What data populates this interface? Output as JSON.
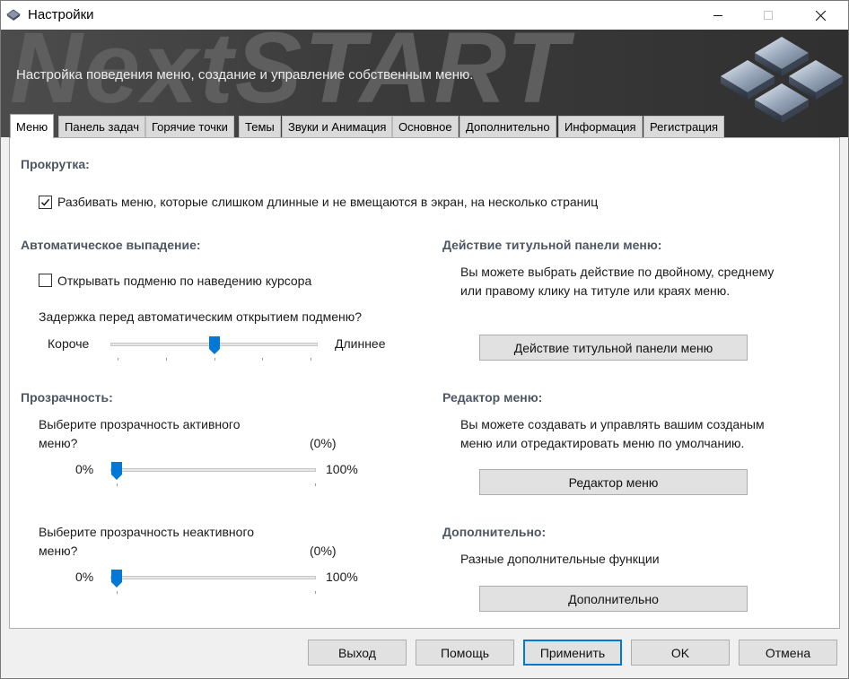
{
  "window": {
    "title": "Настройки"
  },
  "banner": {
    "logo_text": "NextSTART",
    "subtitle": "Настройка поведения меню, создание и управление собственным меню."
  },
  "tabs": [
    {
      "label": "Меню",
      "active": true
    },
    {
      "label": "Панель задач"
    },
    {
      "label": "Горячие точки"
    },
    {
      "label": "Темы"
    },
    {
      "label": "Звуки и Анимация"
    },
    {
      "label": "Основное"
    },
    {
      "label": "Дополнительно"
    },
    {
      "label": "Информация"
    },
    {
      "label": "Регистрация"
    }
  ],
  "scroll": {
    "title": "Прокрутка:",
    "split_checkbox_label": "Разбивать меню, которые слишком длинные и не вмещаются в экран, на несколько страниц",
    "split_checked": true
  },
  "auto_popup": {
    "title": "Автоматическое выпадение:",
    "hover_checkbox_label": "Открывать подменю по наведению курсора",
    "hover_checked": false,
    "delay_label": "Задержка перед автоматическим открытием подменю?",
    "min_label": "Короче",
    "max_label": "Длиннее",
    "delay_value": 0.5
  },
  "transparency": {
    "title": "Прозрачность:",
    "active_label_line1": "Выберите прозрачность активного",
    "active_label_line2": "меню?",
    "active_value": "(0%)",
    "active_min": "0%",
    "active_max": "100%",
    "active_level": 0,
    "inactive_label_line1": "Выберите прозрачность неактивного",
    "inactive_label_line2": "меню?",
    "inactive_value": "(0%)",
    "inactive_min": "0%",
    "inactive_max": "100%",
    "inactive_level": 0
  },
  "title_action": {
    "title": "Действие титульной панели меню:",
    "desc_line1": "Вы можете выбрать действие по двойному, среднему",
    "desc_line2": "или правому клику на титуле или краях меню.",
    "button": "Действие титульной панели меню"
  },
  "menu_editor": {
    "title": "Редактор меню:",
    "desc_line1": "Вы можете создавать и управлять вашим созданым",
    "desc_line2": "меню или отредактировать меню по умолчанию.",
    "button": "Редактор меню"
  },
  "extra": {
    "title": "Дополнительно:",
    "desc": "Разные дополнительные функции",
    "button": "Дополнительно"
  },
  "footer": {
    "exit": "Выход",
    "help": "Помощь",
    "apply": "Применить",
    "ok": "OK",
    "cancel": "Отмена"
  },
  "colors": {
    "accent": "#0078d7",
    "section_title": "#4d5663",
    "banner_bg": "#3c3c3c"
  }
}
